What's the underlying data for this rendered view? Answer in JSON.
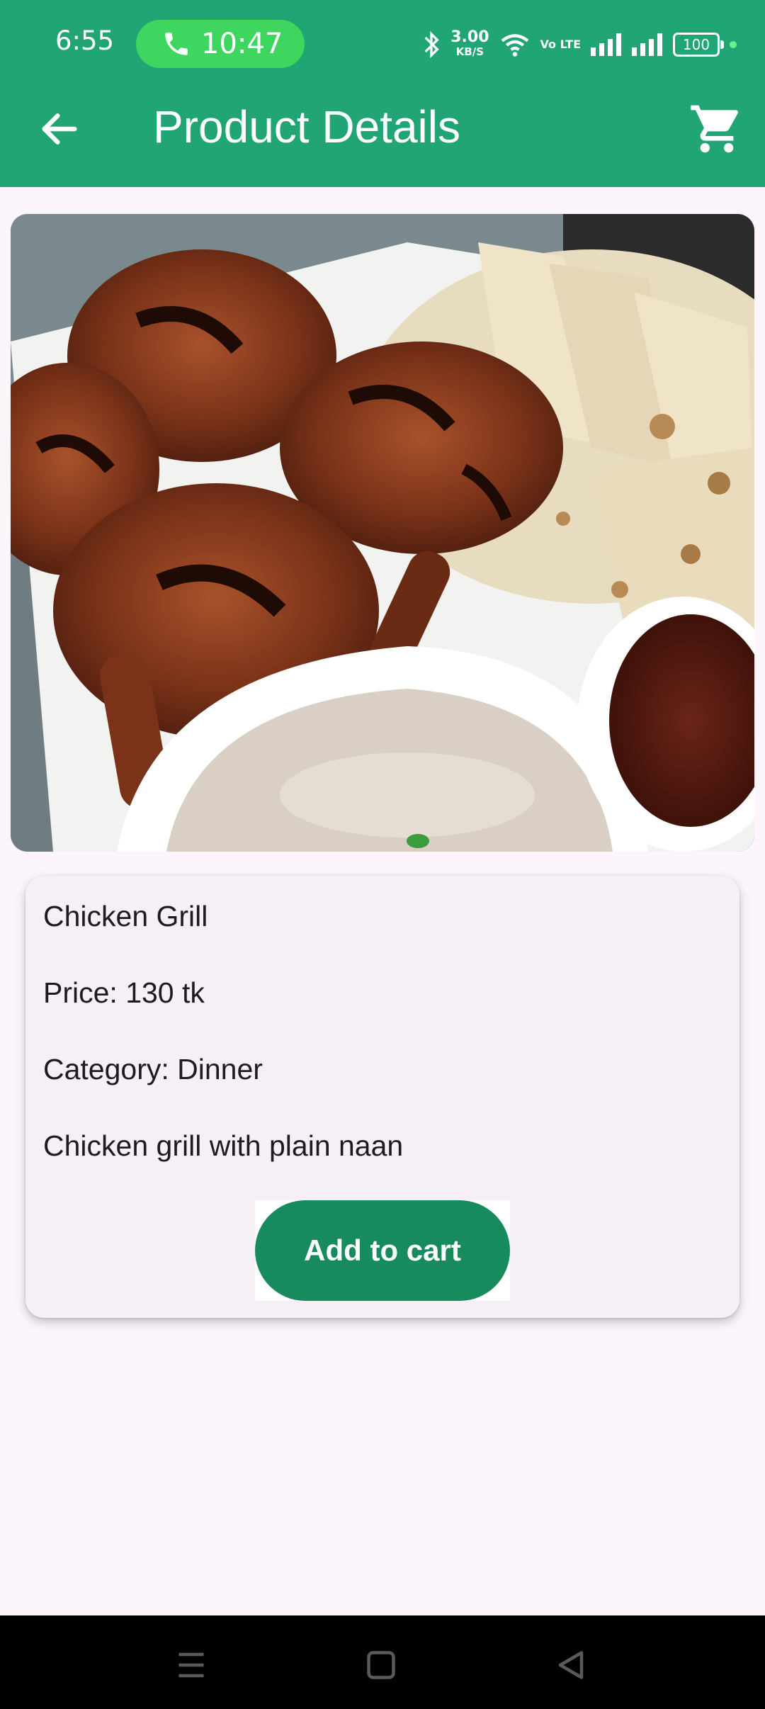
{
  "status_bar": {
    "time": "6:55",
    "call_timer": "10:47",
    "net_speed_value": "3.00",
    "net_speed_unit": "KB/S",
    "volte": "Vo LTE",
    "battery": "100"
  },
  "app_bar": {
    "title": "Product Details"
  },
  "product": {
    "image_alt": "Grilled chicken with plain naan, white dip and red sauce",
    "name": "Chicken Grill",
    "price": "Price: 130 tk",
    "category": "Category: Dinner",
    "description": "Chicken grill with plain naan",
    "add_to_cart_label": "Add to cart"
  },
  "colors": {
    "primary": "#22a574",
    "button": "#178a5e",
    "background": "#fcf5fb",
    "card": "#f6eff6"
  },
  "icons": {
    "back": "arrow-back-icon",
    "cart": "shopping-cart-icon",
    "call": "phone-icon",
    "nav_menu": "menu-icon",
    "nav_home": "home-square-icon",
    "nav_back": "back-triangle-icon"
  }
}
